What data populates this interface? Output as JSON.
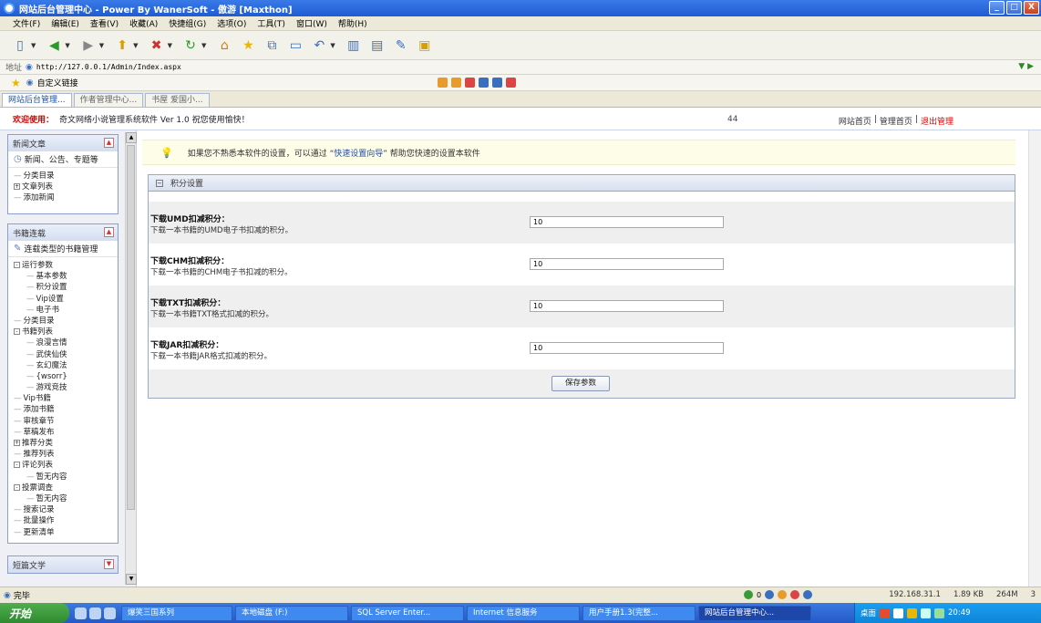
{
  "window": {
    "title": "网站后台管理中心 - Power By WanerSoft - 傲游 [Maxthon]",
    "controls": [
      "_",
      "□",
      "X"
    ]
  },
  "menu": [
    "文件(F)",
    "编辑(E)",
    "查看(V)",
    "收藏(A)",
    "快捷组(G)",
    "选项(O)",
    "工具(T)",
    "窗口(W)",
    "帮助(H)"
  ],
  "address": {
    "label": "地址",
    "url": "http://127.0.0.1/Admin/Index.aspx"
  },
  "favorites": {
    "label": "自定义链接"
  },
  "tabs": [
    {
      "label": "网站后台管理..."
    },
    {
      "label": "作者管理中心..."
    },
    {
      "label": "书屋 爱国小..."
    }
  ],
  "welcome": {
    "label": "欢迎使用：",
    "text": "奇文网络小说管理系统软件 Ver 1.0  祝您使用愉快！",
    "mid": "44",
    "links": {
      "home": "网站首页",
      "sep": "|",
      "admin": "管理首页",
      "logout": "退出管理"
    }
  },
  "sidebar": {
    "panel_news": {
      "title": "新闻文章",
      "sub": "新闻、公告、专题等",
      "items": [
        "分类目录",
        "文章列表",
        "添加新闻"
      ]
    },
    "panel_books": {
      "title": "书籍连载",
      "sub": "连载类型的书籍管理",
      "items": [
        {
          "label": "运行参数",
          "level": 1,
          "box": "-"
        },
        {
          "label": "基本参数",
          "level": 2
        },
        {
          "label": "积分设置",
          "level": 2
        },
        {
          "label": "Vip设置",
          "level": 2
        },
        {
          "label": "电子书",
          "level": 2
        },
        {
          "label": "分类目录",
          "level": 1
        },
        {
          "label": "书籍列表",
          "level": 1,
          "box": "-"
        },
        {
          "label": "浪漫言情",
          "level": 2
        },
        {
          "label": "武侠仙侠",
          "level": 2
        },
        {
          "label": "玄幻魔法",
          "level": 2
        },
        {
          "label": "{wsorr}",
          "level": 2
        },
        {
          "label": "游戏竞技",
          "level": 2
        },
        {
          "label": "Vip书籍",
          "level": 1
        },
        {
          "label": "添加书籍",
          "level": 1
        },
        {
          "label": "审核章节",
          "level": 1
        },
        {
          "label": "草稿发布",
          "level": 1
        },
        {
          "label": "推荐分类",
          "level": 1,
          "box": "+"
        },
        {
          "label": "推荐列表",
          "level": 1
        },
        {
          "label": "评论列表",
          "level": 1,
          "box": "-"
        },
        {
          "label": "暂无内容",
          "level": 2
        },
        {
          "label": "投票调查",
          "level": 1,
          "box": "-"
        },
        {
          "label": "暂无内容",
          "level": 2
        },
        {
          "label": "搜索记录",
          "level": 1
        },
        {
          "label": "批量操作",
          "level": 1
        },
        {
          "label": "更新清单",
          "level": 1
        }
      ]
    },
    "panel_short": {
      "title": "短篇文学"
    }
  },
  "tip": {
    "before": "如果您不熟悉本软件的设置，可以通过 “",
    "link": "快速设置向导",
    "after": "” 帮助您快速的设置本软件"
  },
  "settings": {
    "title": "积分设置",
    "rows": [
      {
        "label": "下载UMD扣减积分：",
        "desc": "下载一本书籍的UMD电子书扣减的积分。",
        "value": "10"
      },
      {
        "label": "下载CHM扣减积分：",
        "desc": "下载一本书籍的CHM电子书扣减的积分。",
        "value": "10"
      },
      {
        "label": "下载TXT扣减积分：",
        "desc": "下载一本书籍TXT格式扣减的积分。",
        "value": "10"
      },
      {
        "label": "下载JAR扣减积分：",
        "desc": "下载一本书籍JAR格式扣减的积分。",
        "value": "10"
      }
    ],
    "save_label": "保存参数"
  },
  "status": {
    "done": "完毕",
    "counter": "0",
    "ip": "192.168.31.1",
    "size": "1.89 KB",
    "mem": "264M",
    "num": "3"
  },
  "taskbar": {
    "start": "开始",
    "tasks": [
      "爆笑三国系列",
      "本地磁盘 (F:)",
      "SQL Server Enter...",
      "Internet 信息服务",
      "用户手册1.3(完整...",
      "网站后台管理中心..."
    ],
    "tray_label": "桌面",
    "time": "20:49"
  }
}
